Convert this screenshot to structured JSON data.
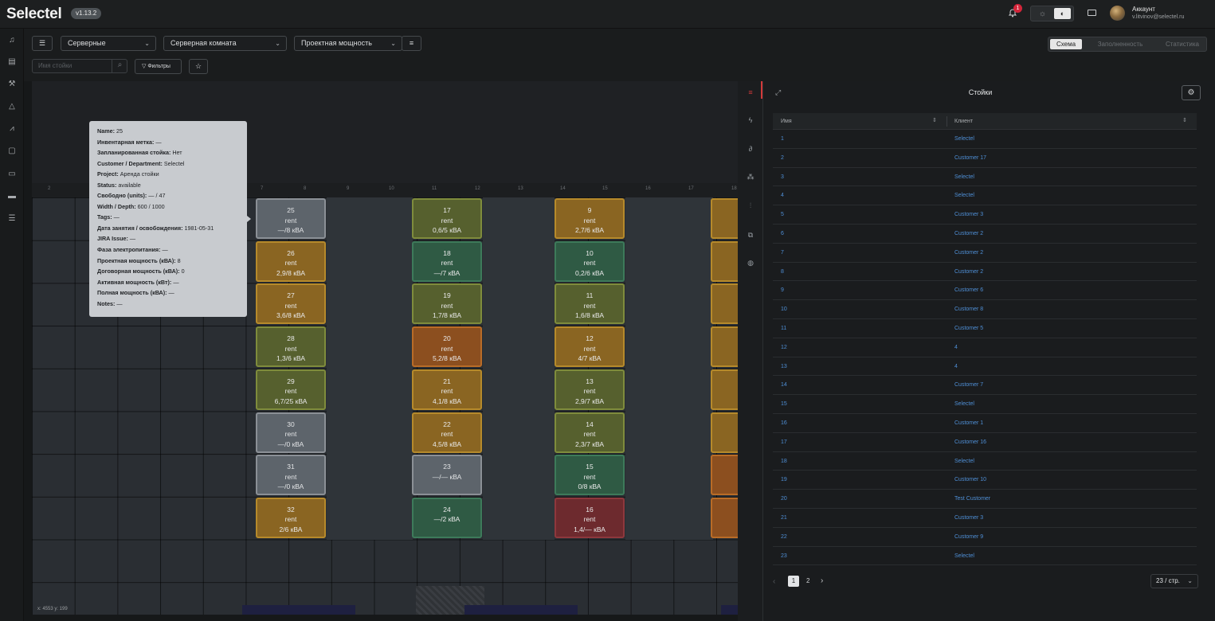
{
  "header": {
    "logo": "Selectel",
    "version": "v1.13.2",
    "notification_count": "1",
    "account_title": "Аккаунт",
    "account_email": "v.litvinov@selectel.ru"
  },
  "toolbar": {
    "select_type": "Серверные",
    "select_room": "Серверная комната",
    "select_metric": "Проектная мощность",
    "search_placeholder": "Имя стойки",
    "filters_label": "Фильтры",
    "views": [
      "Схема",
      "Заполненность",
      "Статистика"
    ],
    "active_view": "Схема"
  },
  "ruler": [
    "2",
    "3",
    "4",
    "5",
    "6",
    "7",
    "8",
    "9",
    "10",
    "11",
    "12",
    "13",
    "14",
    "15",
    "16",
    "17",
    "18"
  ],
  "racks": [
    {
      "id": "25",
      "status": "rent",
      "power": "—/8 кВА",
      "color": "gray"
    },
    {
      "id": "26",
      "status": "rent",
      "power": "2,9/8 кВА",
      "color": "orange"
    },
    {
      "id": "27",
      "status": "rent",
      "power": "3,6/8 кВА",
      "color": "orange"
    },
    {
      "id": "28",
      "status": "rent",
      "power": "1,3/6 кВА",
      "color": "olive"
    },
    {
      "id": "29",
      "status": "rent",
      "power": "6,7/25 кВА",
      "color": "olive"
    },
    {
      "id": "30",
      "status": "rent",
      "power": "—/0 кВА",
      "color": "gray"
    },
    {
      "id": "31",
      "status": "rent",
      "power": "—/0 кВА",
      "color": "gray"
    },
    {
      "id": "32",
      "status": "rent",
      "power": "2/6 кВА",
      "color": "orange"
    },
    {
      "id": "17",
      "status": "rent",
      "power": "0,6/5 кВА",
      "color": "olive"
    },
    {
      "id": "18",
      "status": "rent",
      "power": "—/7 кВА",
      "color": "green"
    },
    {
      "id": "19",
      "status": "rent",
      "power": "1,7/8 кВА",
      "color": "olive"
    },
    {
      "id": "20",
      "status": "rent",
      "power": "5,2/8 кВА",
      "color": "dorange"
    },
    {
      "id": "21",
      "status": "rent",
      "power": "4,1/8 кВА",
      "color": "orange"
    },
    {
      "id": "22",
      "status": "rent",
      "power": "4,5/8 кВА",
      "color": "orange"
    },
    {
      "id": "23",
      "status": "",
      "power": "—/— кВА",
      "color": "gray"
    },
    {
      "id": "24",
      "status": "",
      "power": "—/2 кВА",
      "color": "green"
    },
    {
      "id": "9",
      "status": "rent",
      "power": "2,7/6 кВА",
      "color": "orange"
    },
    {
      "id": "10",
      "status": "rent",
      "power": "0,2/6 кВА",
      "color": "green"
    },
    {
      "id": "11",
      "status": "rent",
      "power": "1,6/8 кВА",
      "color": "olive"
    },
    {
      "id": "12",
      "status": "rent",
      "power": "4/7 кВА",
      "color": "orange"
    },
    {
      "id": "13",
      "status": "rent",
      "power": "2,9/7 кВА",
      "color": "olive"
    },
    {
      "id": "14",
      "status": "rent",
      "power": "2,3/7 кВА",
      "color": "olive"
    },
    {
      "id": "15",
      "status": "rent",
      "power": "0/8 кВА",
      "color": "green"
    },
    {
      "id": "16",
      "status": "rent",
      "power": "1,4/— кВА",
      "color": "red"
    }
  ],
  "tooltip": [
    {
      "k": "Name:",
      "v": "25"
    },
    {
      "k": "Инвентарная метка:",
      "v": "—"
    },
    {
      "k": "Запланированная стойка:",
      "v": "Нет"
    },
    {
      "k": "Customer / Department:",
      "v": "Selectel"
    },
    {
      "k": "Project:",
      "v": "Аренда стойки"
    },
    {
      "k": "Status:",
      "v": "available"
    },
    {
      "k": "Свободно (units):",
      "v": "— / 47"
    },
    {
      "k": "Width / Depth:",
      "v": "600 / 1000"
    },
    {
      "k": "Tags:",
      "v": "—"
    },
    {
      "k": "Дата занятия / освобождения:",
      "v": "1981-05-31"
    },
    {
      "k": "JIRA Issue:",
      "v": "—"
    },
    {
      "k": "Фаза электропитания:",
      "v": "—"
    },
    {
      "k": "Проектная мощность (кВА):",
      "v": "8"
    },
    {
      "k": "Договорная мощность (кВА):",
      "v": "0"
    },
    {
      "k": "Активная мощность (кВт):",
      "v": "—"
    },
    {
      "k": "Полная мощность (кВА):",
      "v": "—"
    },
    {
      "k": "Notes:",
      "v": "—"
    }
  ],
  "coords": "x: 4553  y: 199",
  "panel": {
    "title": "Стойки",
    "col_name": "Имя",
    "col_client": "Клиент",
    "rows": [
      {
        "n": "1",
        "c": "Selectel"
      },
      {
        "n": "2",
        "c": "Customer 17"
      },
      {
        "n": "3",
        "c": "Selectel"
      },
      {
        "n": "4",
        "c": "Selectel"
      },
      {
        "n": "5",
        "c": "Customer 3"
      },
      {
        "n": "6",
        "c": "Customer 2"
      },
      {
        "n": "7",
        "c": "Customer 2"
      },
      {
        "n": "8",
        "c": "Customer 2"
      },
      {
        "n": "9",
        "c": "Customer 6"
      },
      {
        "n": "10",
        "c": "Customer 8"
      },
      {
        "n": "11",
        "c": "Customer 5"
      },
      {
        "n": "12",
        "c": "4"
      },
      {
        "n": "13",
        "c": "4"
      },
      {
        "n": "14",
        "c": "Customer 7"
      },
      {
        "n": "15",
        "c": "Selectel"
      },
      {
        "n": "16",
        "c": "Customer 1"
      },
      {
        "n": "17",
        "c": "Customer 16"
      },
      {
        "n": "18",
        "c": "Selectel"
      },
      {
        "n": "19",
        "c": "Customer 10"
      },
      {
        "n": "20",
        "c": "Test Customer"
      },
      {
        "n": "21",
        "c": "Customer 3"
      },
      {
        "n": "22",
        "c": "Customer 9"
      },
      {
        "n": "23",
        "c": "Selectel"
      }
    ],
    "pages": [
      "1",
      "2"
    ],
    "page_size": "23 / стр."
  }
}
